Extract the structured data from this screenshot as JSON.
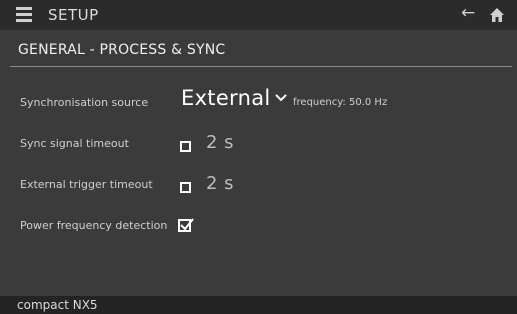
{
  "header": {
    "title": "SETUP",
    "menu_icon": "menu-icon",
    "back_icon": "back-arrow-icon",
    "home_icon": "home-icon"
  },
  "section": {
    "title": "GENERAL - PROCESS & SYNC"
  },
  "settings": {
    "sync_source": {
      "label": "Synchronisation source",
      "value": "External",
      "frequency": "frequency: 50.0 Hz"
    },
    "sync_timeout": {
      "label": "Sync signal timeout",
      "checked": false,
      "value": "2 s"
    },
    "ext_trigger_timeout": {
      "label": "External trigger timeout",
      "checked": false,
      "value": "2 s"
    },
    "power_freq_detection": {
      "label": "Power frequency detection",
      "checked": true
    }
  },
  "footer": {
    "device": "compact NX5"
  },
  "colors": {
    "background": "#3b3b3b",
    "topbar": "#2b2b2b",
    "footer": "#242424",
    "text": "#e8e8e8"
  }
}
